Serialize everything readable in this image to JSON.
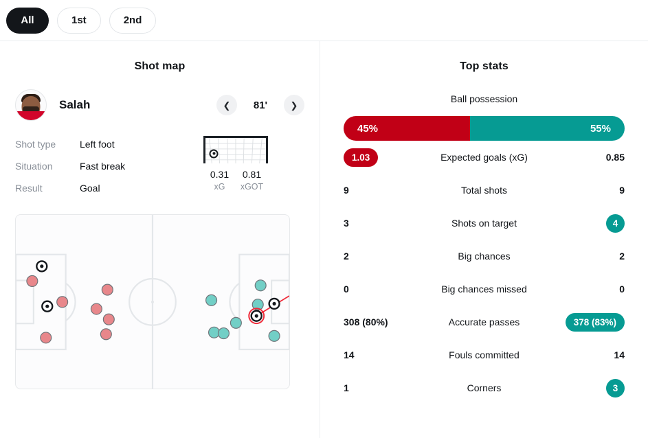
{
  "tabs": [
    {
      "label": "All",
      "active": true
    },
    {
      "label": "1st",
      "active": false
    },
    {
      "label": "2nd",
      "active": false
    }
  ],
  "shot_map": {
    "title": "Shot map",
    "player": {
      "name": "Salah"
    },
    "nav": {
      "prev_icon": "chevron-left-icon",
      "next_icon": "chevron-right-icon",
      "minute": "81'"
    },
    "details": [
      {
        "label": "Shot type",
        "value": "Left foot"
      },
      {
        "label": "Situation",
        "value": "Fast break"
      },
      {
        "label": "Result",
        "value": "Goal"
      }
    ],
    "goal_mouth": {
      "xg": {
        "value": "0.31",
        "label": "xG"
      },
      "xgot": {
        "value": "0.81",
        "label": "xGOT"
      },
      "placement_x_pct": 14,
      "placement_y_pct": 62
    }
  },
  "top_stats": {
    "title": "Top stats",
    "possession": {
      "label": "Ball possession",
      "home": "45%",
      "away": "55%",
      "home_pct": 45,
      "away_pct": 55
    },
    "rows": [
      {
        "name": "Expected goals (xG)",
        "home": "1.03",
        "away": "0.85",
        "home_badge": "red-rect",
        "away_badge": "none"
      },
      {
        "name": "Total shots",
        "home": "9",
        "away": "9",
        "home_badge": "none",
        "away_badge": "none"
      },
      {
        "name": "Shots on target",
        "home": "3",
        "away": "4",
        "home_badge": "none",
        "away_badge": "teal-circle"
      },
      {
        "name": "Big chances",
        "home": "2",
        "away": "2",
        "home_badge": "none",
        "away_badge": "none"
      },
      {
        "name": "Big chances missed",
        "home": "0",
        "away": "0",
        "home_badge": "none",
        "away_badge": "none"
      },
      {
        "name": "Accurate passes",
        "home": "308 (80%)",
        "away": "378 (83%)",
        "home_badge": "none",
        "away_badge": "teal-rect"
      },
      {
        "name": "Fouls committed",
        "home": "14",
        "away": "14",
        "home_badge": "none",
        "away_badge": "none"
      },
      {
        "name": "Corners",
        "home": "1",
        "away": "3",
        "home_badge": "none",
        "away_badge": "teal-circle"
      }
    ]
  },
  "colors": {
    "home": "#c10016",
    "away": "#069b93",
    "home_dot": "#e8878b",
    "away_dot": "#72cfc6",
    "dot_stroke": "#6f7479",
    "selected_ring": "#ef2b3a",
    "pitch_line": "#e4e7ea"
  },
  "chart_data": {
    "type": "scatter",
    "title": "Shot map",
    "xlabel": "",
    "ylabel": "",
    "xlim": [
      0,
      100
    ],
    "ylim": [
      0,
      100
    ],
    "grid": false,
    "legend": "none",
    "series": [
      {
        "name": "Home shots",
        "color": "#e8878b",
        "points": [
          {
            "x": 6.0,
            "y": 38.0,
            "type": "shot"
          },
          {
            "x": 9.5,
            "y": 29.5,
            "type": "goal"
          },
          {
            "x": 17.0,
            "y": 50.0,
            "type": "shot"
          },
          {
            "x": 11.5,
            "y": 52.5,
            "type": "goal"
          },
          {
            "x": 11.0,
            "y": 70.5,
            "type": "shot"
          },
          {
            "x": 33.5,
            "y": 43.0,
            "type": "shot"
          },
          {
            "x": 29.5,
            "y": 54.0,
            "type": "shot"
          },
          {
            "x": 34.0,
            "y": 60.0,
            "type": "shot"
          },
          {
            "x": 33.0,
            "y": 68.5,
            "type": "shot"
          }
        ]
      },
      {
        "name": "Away shots",
        "color": "#72cfc6",
        "points": [
          {
            "x": 71.5,
            "y": 49.0,
            "type": "shot"
          },
          {
            "x": 72.5,
            "y": 67.5,
            "type": "shot"
          },
          {
            "x": 76.0,
            "y": 68.0,
            "type": "shot"
          },
          {
            "x": 80.5,
            "y": 62.0,
            "type": "shot"
          },
          {
            "x": 89.5,
            "y": 40.5,
            "type": "shot"
          },
          {
            "x": 88.5,
            "y": 51.5,
            "type": "shot"
          },
          {
            "x": 88.0,
            "y": 58.0,
            "type": "goal",
            "selected": true
          },
          {
            "x": 94.5,
            "y": 51.0,
            "type": "goal"
          },
          {
            "x": 94.5,
            "y": 69.5,
            "type": "shot"
          }
        ]
      }
    ],
    "annotations": [
      {
        "type": "trajectory",
        "from": [
          88.0,
          58.0
        ],
        "to": [
          100.0,
          46.5
        ],
        "color": "#ef2b3a"
      }
    ]
  }
}
